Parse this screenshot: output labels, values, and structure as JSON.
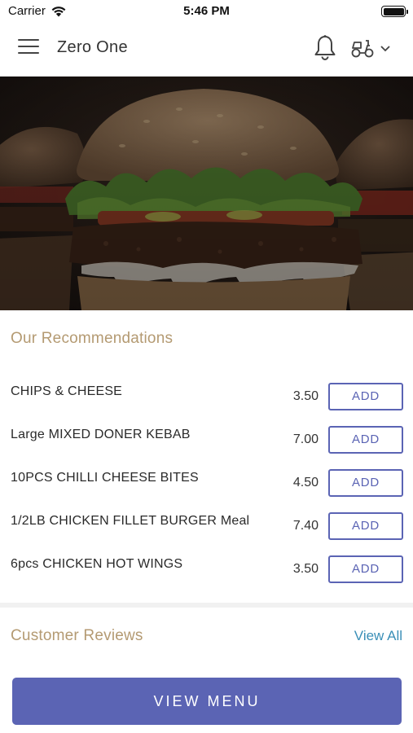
{
  "status_bar": {
    "carrier": "Carrier",
    "time": "5:46 PM",
    "icons": [
      "wifi-icon",
      "battery-icon"
    ]
  },
  "header": {
    "title": "Zero One",
    "icons": [
      "hamburger-menu-icon",
      "bell-icon",
      "scooter-delivery-icon",
      "chevron-down-icon"
    ]
  },
  "hero": {
    "image": "burger-photo"
  },
  "recommendations": {
    "title": "Our Recommendations",
    "add_label": "ADD",
    "items": [
      {
        "name": "CHIPS & CHEESE",
        "price": "3.50"
      },
      {
        "name": "Large MIXED DONER KEBAB",
        "price": "7.00"
      },
      {
        "name": "10PCS CHILLI CHEESE BITES",
        "price": "4.50"
      },
      {
        "name": "1/2LB CHICKEN FILLET BURGER Meal",
        "price": "7.40"
      },
      {
        "name": "6pcs CHICKEN HOT WINGS",
        "price": "3.50"
      }
    ]
  },
  "reviews": {
    "title": "Customer Reviews",
    "view_all_label": "View All"
  },
  "footer": {
    "view_menu_label": "VIEW MENU"
  },
  "colors": {
    "accent": "#5b64b4",
    "section_title": "#b49a72",
    "link": "#3a8fb7"
  }
}
